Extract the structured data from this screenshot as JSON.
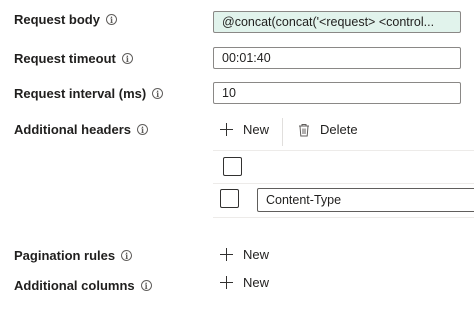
{
  "fields": {
    "request_body": {
      "label": "Request body",
      "value": "@concat(concat('<request> <control..."
    },
    "request_timeout": {
      "label": "Request timeout",
      "value": "00:01:40"
    },
    "request_interval": {
      "label": "Request interval (ms)",
      "value": "10"
    }
  },
  "additional_headers": {
    "label": "Additional headers",
    "new_label": "New",
    "delete_label": "Delete",
    "rows": [
      {
        "name": "Content-Type"
      }
    ]
  },
  "pagination_rules": {
    "label": "Pagination rules",
    "new_label": "New"
  },
  "additional_columns": {
    "label": "Additional columns",
    "new_label": "New"
  },
  "icons": {
    "info": "info-icon",
    "add": "plus-icon",
    "delete": "trash-icon"
  },
  "colors": {
    "expression_bg": "#e1f3ec",
    "border": "#8a8886",
    "text": "#201f1e"
  }
}
